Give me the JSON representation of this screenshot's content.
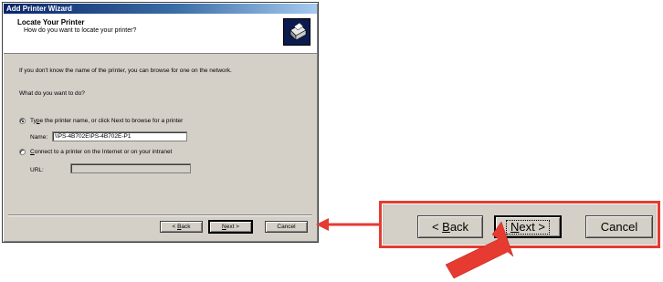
{
  "window": {
    "title": "Add Printer Wizard",
    "header_title": "Locate Your Printer",
    "header_subtitle": "How do you want to locate your printer?",
    "intro_text": "If you don't know the name of the printer, you can browse for one on the network.",
    "question": "What do you want to do?",
    "option1": {
      "prefix": "Ty",
      "accel": "p",
      "rest": "e the printer name, or click Next to browse for a printer",
      "checked": true
    },
    "name_label": "Name:",
    "name_value": "\\\\PS-4B702E\\PS-4B702E-P1",
    "option2": {
      "accel": "C",
      "rest": "onnect to a printer on the Internet or on your intranet",
      "checked": false
    },
    "url_label": "URL:",
    "url_value": "",
    "buttons": {
      "back": {
        "prefix": "< ",
        "accel": "B",
        "rest": "ack"
      },
      "next": {
        "accel": "N",
        "rest": "ext >"
      },
      "cancel": "Cancel"
    }
  },
  "zoom": {
    "back": {
      "prefix": "< ",
      "accel": "B",
      "rest": "ack"
    },
    "next": {
      "accel": "N",
      "rest": "ext >"
    },
    "cancel": "Cancel"
  },
  "colors": {
    "callout": "#e53b31",
    "titlebar": "#0a246a",
    "dialog_bg": "#d4d0c8"
  }
}
